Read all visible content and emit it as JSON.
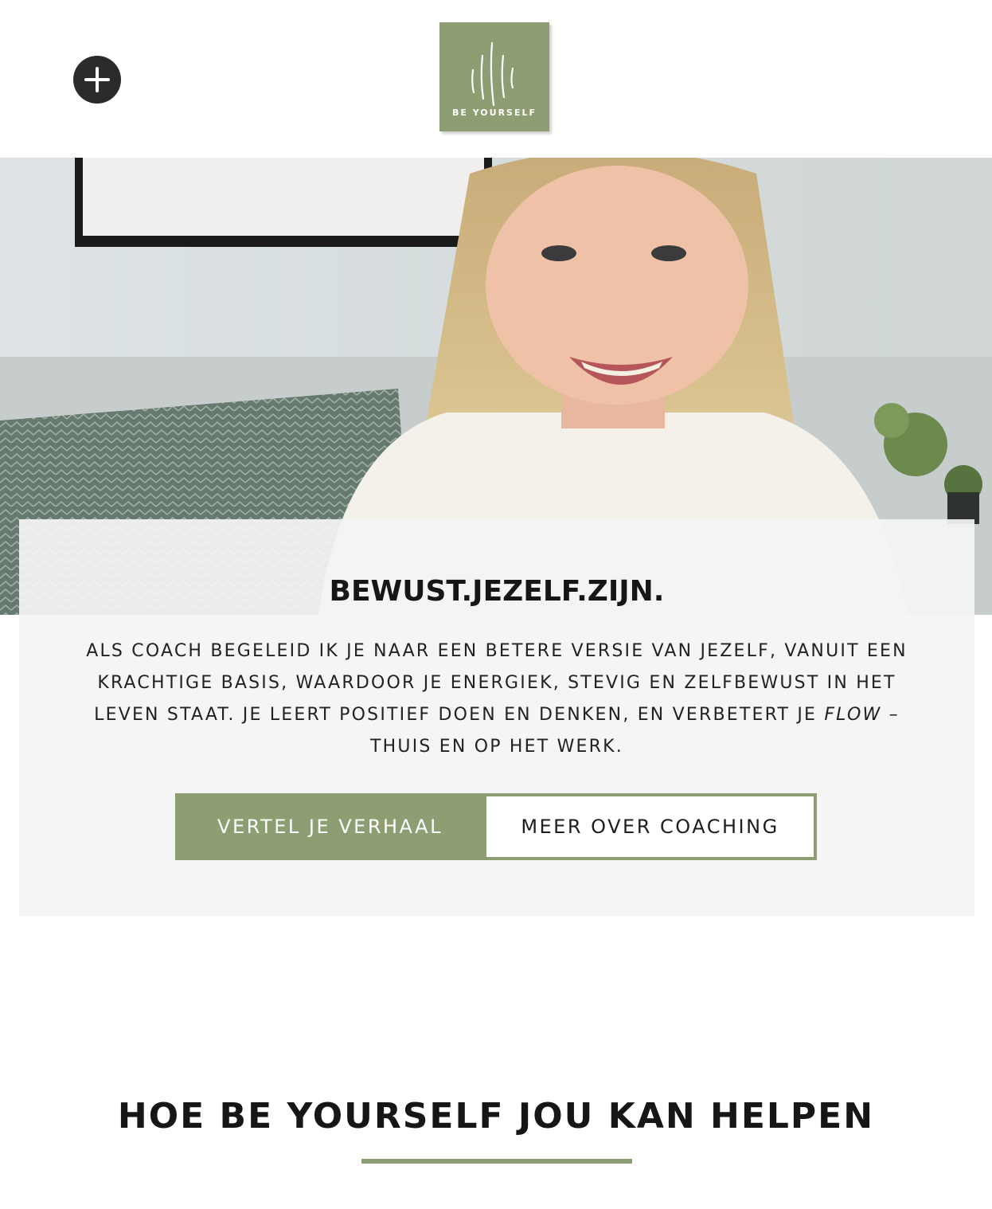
{
  "header": {
    "menu_icon": "plus-icon",
    "logo_text": "BE YOURSELF"
  },
  "hero": {
    "image": "smiling-woman-photo"
  },
  "intro": {
    "title": "BEWUST.JEZELF.ZIJN.",
    "body_part1": "ALS COACH BEGELEID IK JE NAAR EEN BETERE VERSIE VAN JEZELF, VANUIT EEN KRACHTIGE BASIS, WAARDOOR JE ENERGIEK, STEVIG EN ZELFBEWUST IN HET LEVEN STAAT. JE LEERT POSITIEF  DOEN EN DENKEN,  EN VERBETERT JE ",
    "body_emphasis": "FLOW",
    "body_part2": " – THUIS EN OP HET WERK.",
    "primary_button": "VERTEL JE VERHAAL",
    "secondary_button": "MEER OVER COACHING"
  },
  "section": {
    "title": "HOE BE YOURSELF JOU KAN HELPEN"
  },
  "colors": {
    "accent": "#8d9e72",
    "menu_button": "#2b2b2b",
    "panel": "#f4f4f4",
    "text": "#1f1f1f"
  }
}
